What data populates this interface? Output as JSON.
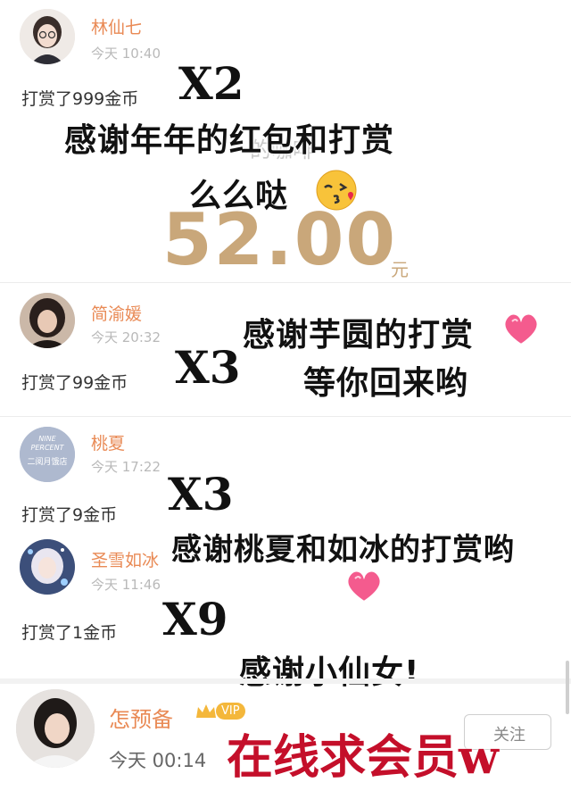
{
  "colors": {
    "name": "#e98a55",
    "time": "#b9b9b9",
    "amount": "#c9a77a",
    "promo": "#c40f2a"
  },
  "entries": [
    {
      "name": "林仙七",
      "time": "今天 10:40",
      "gift": "打赏了999金币",
      "mult": "X2",
      "avatar_icon": "avatar-woman-glasses"
    },
    {
      "name": "简渝媛",
      "time": "今天 20:32",
      "gift": "打赏了99金币",
      "mult": "X3",
      "avatar_icon": "avatar-woman-dark-hair"
    },
    {
      "name": "桃夏",
      "time": "今天 17:22",
      "gift": "打赏了9金币",
      "mult": "X3",
      "avatar_icon": "avatar-text-logo",
      "avatar_text1": "NINE",
      "avatar_text2": "PERCENT",
      "avatar_text3": "二阅月饿店"
    },
    {
      "name": "圣雪如冰",
      "time": "今天 11:46",
      "gift": "打赏了1金币",
      "mult": "X9",
      "avatar_icon": "avatar-anime-girl"
    }
  ],
  "captions": {
    "c1_line1": "感谢年年的红包和打赏",
    "c1_line2": "么么哒",
    "c2_line1": "感谢芋圆的打赏",
    "c2_line2": "等你回来哟",
    "c3": "感谢桃夏和如冰的打赏哟",
    "c4": "感谢小仙女!"
  },
  "red_packet": {
    "amount": "52.00",
    "unit": "元",
    "peek_text": "的咖啡"
  },
  "bottom_user": {
    "name": "怎预备",
    "vip": "VIP",
    "time": "今天 00:14",
    "button_peek": "关注"
  },
  "promo": "在线求会员w"
}
